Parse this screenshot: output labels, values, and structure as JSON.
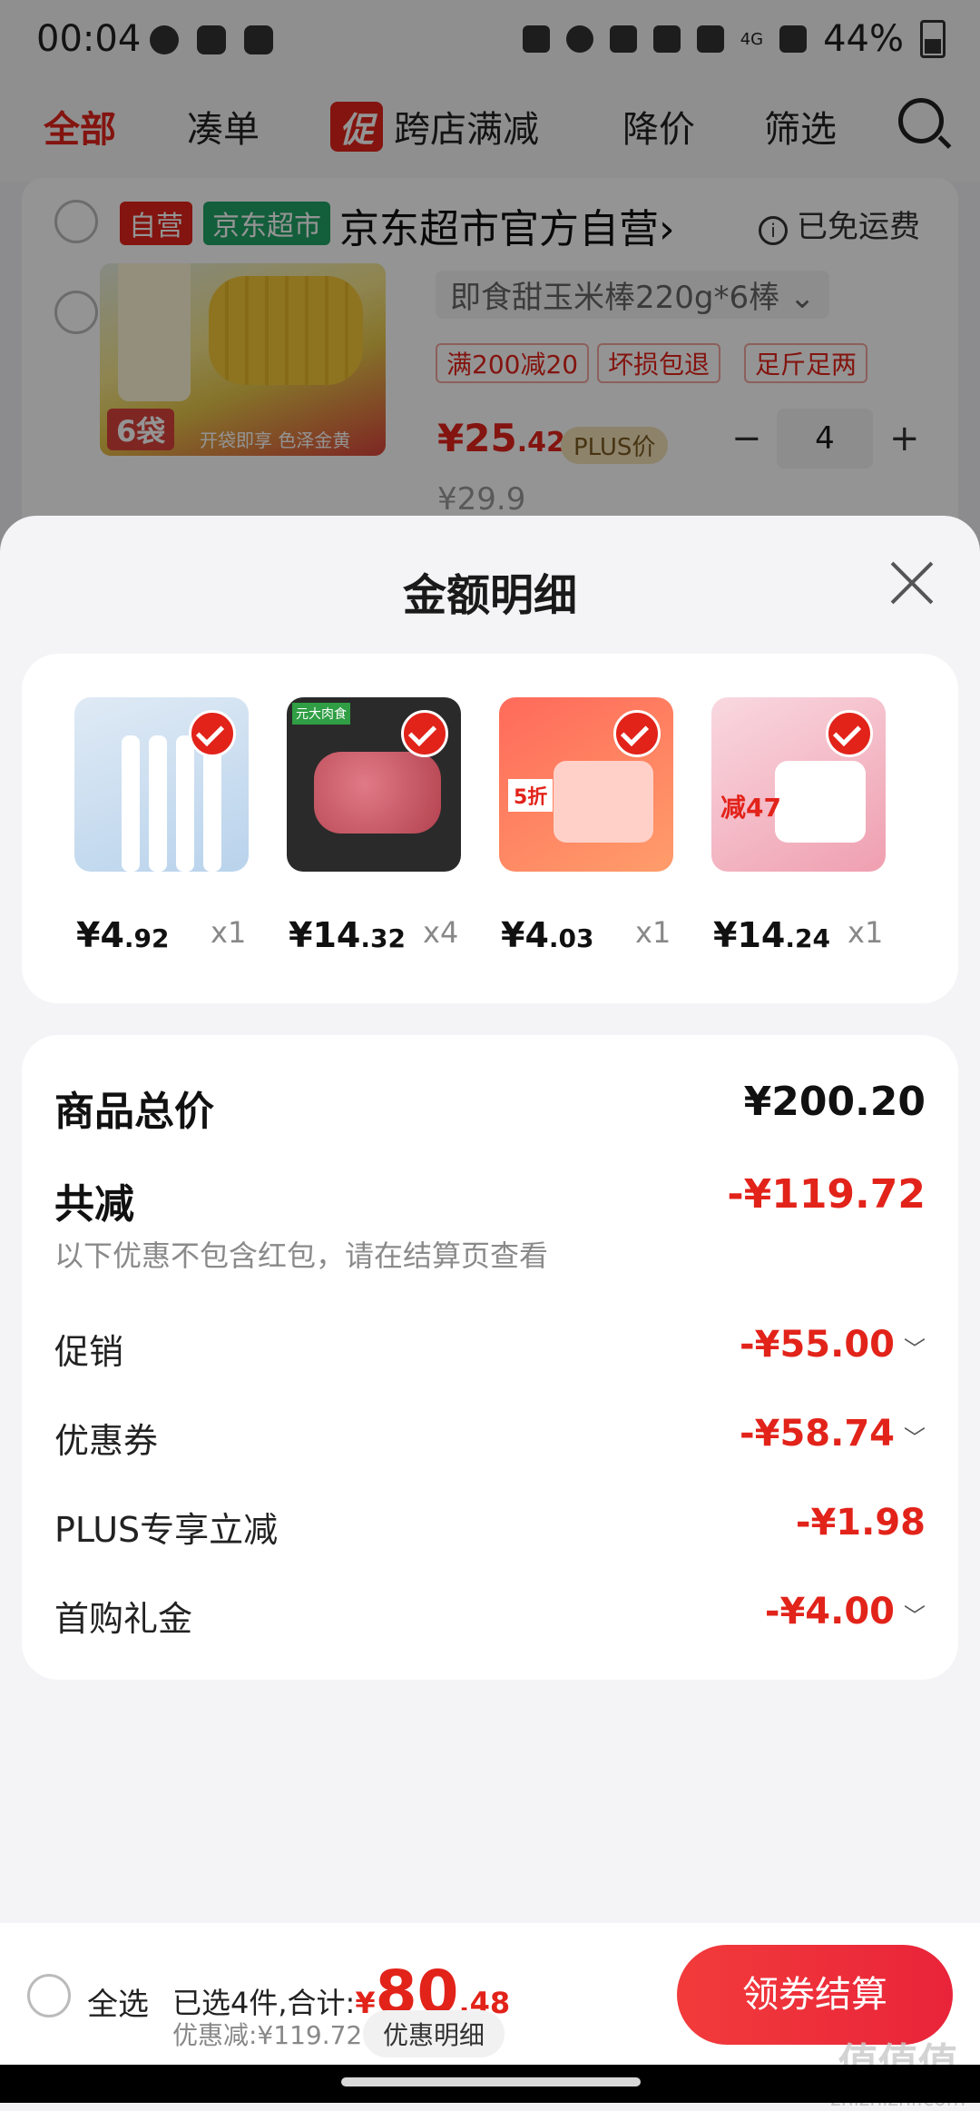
{
  "status_bar": {
    "time": "00:04",
    "network": "4G",
    "battery": "44%"
  },
  "tabs": [
    {
      "label": "全部"
    },
    {
      "label": "凑单"
    },
    {
      "label": "跨店满减",
      "badge": "促"
    },
    {
      "label": "降价"
    },
    {
      "label": "筛选"
    }
  ],
  "shop": {
    "tag_self": "自营",
    "tag_market": "京东超市",
    "name": "京东超市官方自营",
    "chevron": "›",
    "free_shipping": "已免运费"
  },
  "product": {
    "title": "即食甜玉米棒220g*6棒",
    "title_arrow": "⌄",
    "tags": [
      "满200减20",
      "坏损包退",
      "足斤足两"
    ],
    "price_symbol": "¥",
    "price_int": "25",
    "price_dec": ".42",
    "plus_tag": "PLUS价",
    "old_price": "¥29.9",
    "quantity": "4",
    "image_badge": "6袋",
    "image_strip": "开袋即享 色泽金黄"
  },
  "sheet": {
    "title": "金额明细",
    "items": [
      {
        "price_symbol": "¥",
        "price_int": "4",
        "price_dec": ".92",
        "qty": "x1"
      },
      {
        "price_symbol": "¥",
        "price_int": "14",
        "price_dec": ".32",
        "qty": "x4",
        "image_label": "元大肉食"
      },
      {
        "price_symbol": "¥",
        "price_int": "4",
        "price_dec": ".03",
        "qty": "x1",
        "image_label": "5折"
      },
      {
        "price_symbol": "¥",
        "price_int": "14",
        "price_dec": ".24",
        "qty": "x1",
        "image_label": "减47"
      }
    ],
    "total_label": "商品总价",
    "total_value": "¥200.20",
    "discount_label": "共减",
    "discount_value": "-¥119.72",
    "discount_note": "以下优惠不包含红包，请在结算页查看",
    "lines": [
      {
        "label": "促销",
        "value": "-¥55.00",
        "chevron": "﹀"
      },
      {
        "label": "优惠券",
        "value": "-¥58.74",
        "chevron": "﹀"
      },
      {
        "label": "PLUS专享立减",
        "value": "-¥1.98",
        "chevron": ""
      },
      {
        "label": "首购礼金",
        "value": "-¥4.00",
        "chevron": "﹀"
      }
    ]
  },
  "bottom_bar": {
    "select_all": "全选",
    "selected_text": "已选4件,合计:",
    "total_symbol": "¥",
    "total_int": "80",
    "total_dec": ".48",
    "discount_text": "优惠减:¥119.72",
    "detail_chip": "优惠明细",
    "checkout_label": "领券结算"
  },
  "watermark": {
    "logo": "值值值",
    "domain": "zhizhizhi.com"
  },
  "colors": {
    "accent": "#e2231a",
    "market_green": "#21a366",
    "sheet_bg": "#f4f4f6"
  }
}
